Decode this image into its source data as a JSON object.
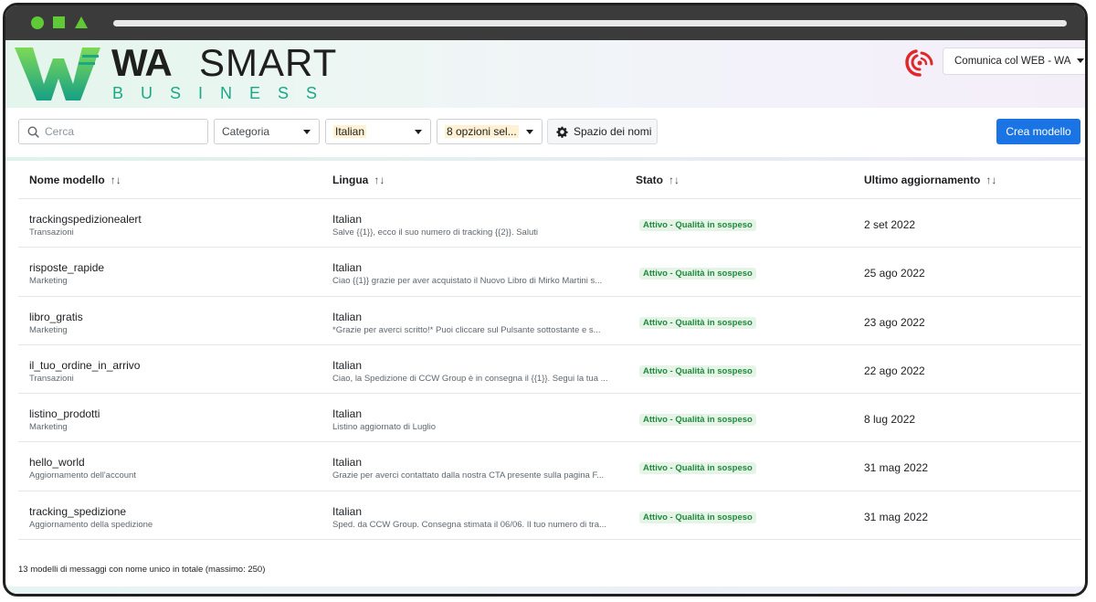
{
  "header": {
    "logo_wa": "WA",
    "logo_smart": "SMART",
    "logo_business": "BUSINESS",
    "account_label": "Comunica col WEB - WA"
  },
  "toolbar": {
    "search_placeholder": "Cerca",
    "category_label": "Categoria",
    "language_label": "Italian",
    "options_label": "8 opzioni sel...",
    "namespace_label": "Spazio dei nomi",
    "create_label": "Crea modello"
  },
  "table": {
    "columns": [
      "Nome modello",
      "Lingua",
      "Stato",
      "Ultimo aggiornamento"
    ],
    "sort_glyph": "↑↓",
    "rows": [
      {
        "name": "trackingspedizionealert",
        "category": "Transazioni",
        "language": "Italian",
        "body": "Salve {{1}}, ecco il suo numero di tracking {{2}}. Saluti",
        "status": "Attivo - Qualità in sospeso",
        "date": "2 set 2022"
      },
      {
        "name": "risposte_rapide",
        "category": "Marketing",
        "language": "Italian",
        "body": "Ciao {{1}} grazie per aver acquistato il Nuovo Libro di Mirko Martini s...",
        "status": "Attivo - Qualità in sospeso",
        "date": "25 ago 2022"
      },
      {
        "name": "libro_gratis",
        "category": "Marketing",
        "language": "Italian",
        "body": "*Grazie per averci scritto!* Puoi cliccare sul Pulsante sottostante e s...",
        "status": "Attivo - Qualità in sospeso",
        "date": "23 ago 2022"
      },
      {
        "name": "il_tuo_ordine_in_arrivo",
        "category": "Transazioni",
        "language": "Italian",
        "body": "Ciao, la Spedizione di CCW Group è in consegna il {{1}}. Segui la tua ...",
        "status": "Attivo - Qualità in sospeso",
        "date": "22 ago 2022"
      },
      {
        "name": "listino_prodotti",
        "category": "Marketing",
        "language": "Italian",
        "body": "Listino aggiornato di Luglio",
        "status": "Attivo - Qualità in sospeso",
        "date": "8 lug 2022"
      },
      {
        "name": "hello_world",
        "category": "Aggiornamento dell'account",
        "language": "Italian",
        "body": "Grazie per averci contattato dalla nostra CTA presente sulla pagina F...",
        "status": "Attivo - Qualità in sospeso",
        "date": "31 mag 2022"
      },
      {
        "name": "tracking_spedizione",
        "category": "Aggiornamento della spedizione",
        "language": "Italian",
        "body": "Sped. da CCW Group. Consegna stimata il 06/06. Il tuo numero di tra...",
        "status": "Attivo - Qualità in sospeso",
        "date": "31 mag 2022"
      }
    ]
  },
  "footer": {
    "summary": "13 modelli di messaggi con nome unico in totale (massimo: 250)"
  },
  "colors": {
    "accent": "#1b74e4",
    "status_green": "#1e8a3c",
    "logo_green": "#1ba886"
  }
}
